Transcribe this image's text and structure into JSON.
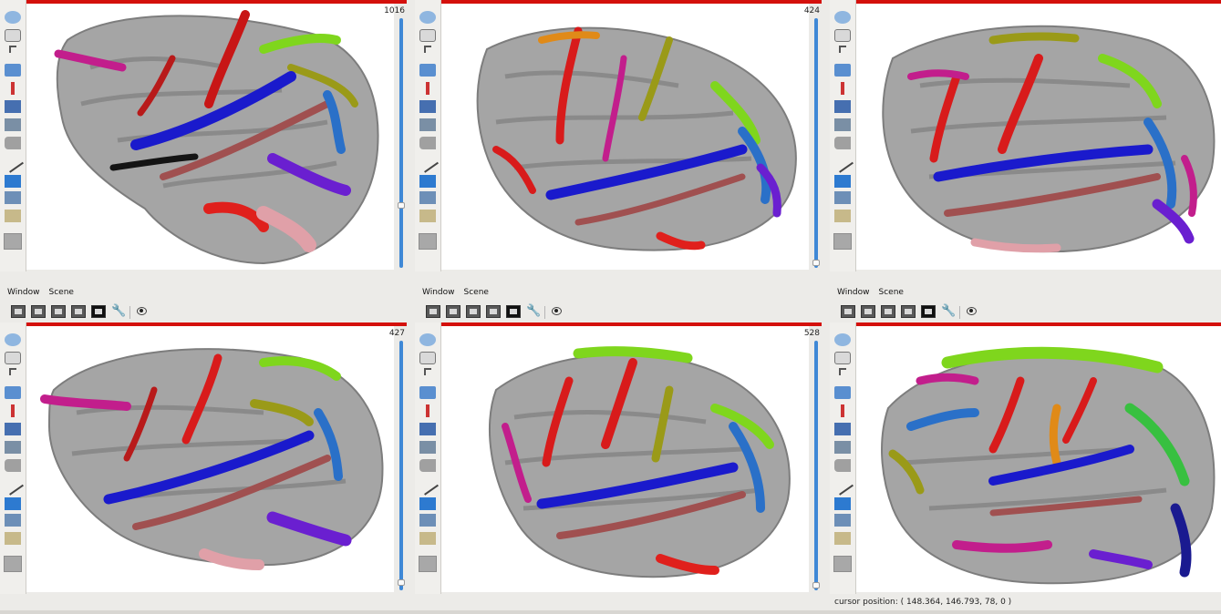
{
  "menus": [
    "Window",
    "Scene"
  ],
  "status": "cursor position: ( 148.364, 146.793, 78, 0 )",
  "tools": [
    "rotate-icon",
    "pan-icon",
    "select-arrow-icon",
    "surface-view-icon",
    "pen-icon",
    "nudge-icon",
    "crop-icon",
    "cut-icon",
    "draw-line-icon",
    "box-icon",
    "layer-icon",
    "landmark-icon",
    "color-swatch"
  ],
  "accent": "#d4100c",
  "sulcal_colors": [
    "#d81b1b",
    "#1a1acc",
    "#c21e8c",
    "#7fd61d",
    "#a05050",
    "#2a70c8",
    "#6a1fd0",
    "#9a9a18",
    "#e0a0a8",
    "#38c040"
  ],
  "windows": [
    {
      "slider_value": "1016",
      "slider_level": 0.75
    },
    {
      "slider_value": "424",
      "slider_level": 0.98
    },
    {
      "slider_value": "427",
      "slider_level": 0.97
    },
    {
      "slider_value": "528",
      "slider_level": 0.98
    }
  ]
}
